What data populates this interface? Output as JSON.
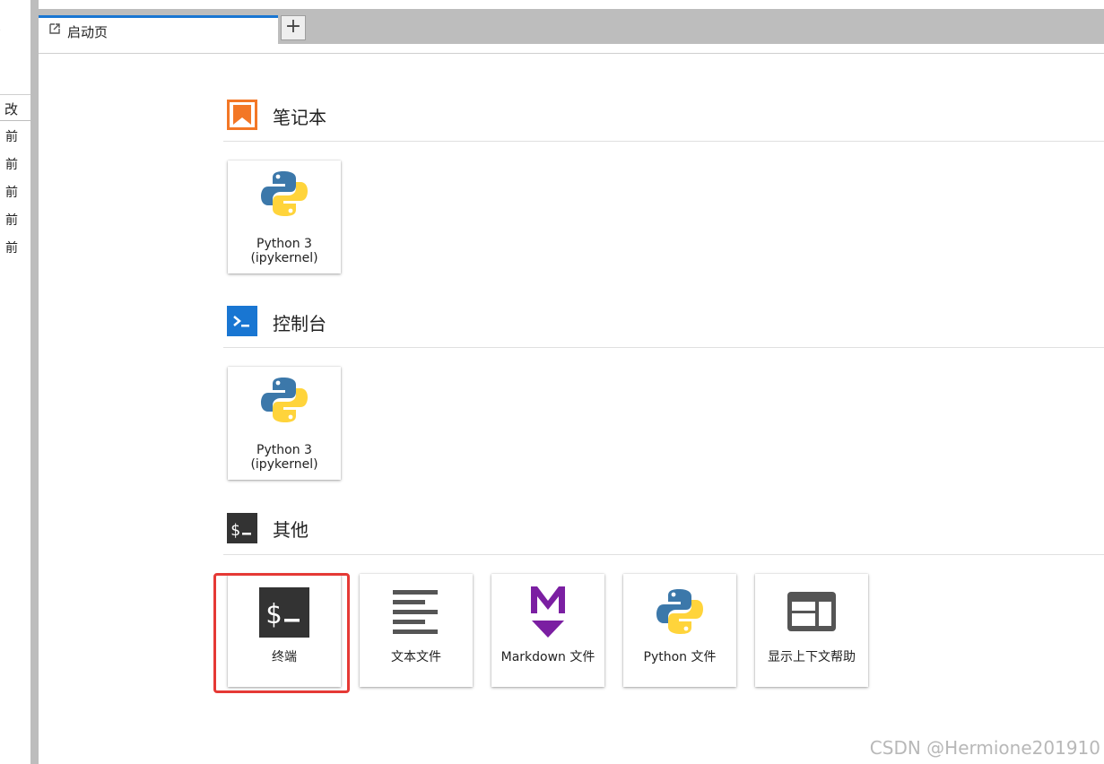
{
  "left_panel": {
    "header_fragment": "改",
    "rows": [
      "前",
      "前",
      "前",
      "前",
      "前"
    ]
  },
  "tabs": [
    {
      "label": "启动页",
      "icon": "launcher-icon",
      "active": true
    }
  ],
  "sections": {
    "notebook": {
      "title": "笔记本",
      "icon": "notebook-bookmark-icon",
      "color": "#f37726",
      "cards": [
        {
          "label_line1": "Python 3",
          "label_line2": "(ipykernel)",
          "icon": "python-logo-icon"
        }
      ]
    },
    "console": {
      "title": "控制台",
      "icon": "console-prompt-icon",
      "color": "#1976d2",
      "cards": [
        {
          "label_line1": "Python 3",
          "label_line2": "(ipykernel)",
          "icon": "python-logo-icon"
        }
      ]
    },
    "other": {
      "title": "其他",
      "icon": "terminal-dollar-icon",
      "color": "#333333",
      "cards": [
        {
          "label": "终端",
          "icon": "terminal-icon"
        },
        {
          "label": "文本文件",
          "icon": "text-file-icon"
        },
        {
          "label": "Markdown 文件",
          "icon": "markdown-icon"
        },
        {
          "label": "Python 文件",
          "icon": "python-logo-icon"
        },
        {
          "label": "显示上下文帮助",
          "icon": "context-help-icon"
        }
      ]
    }
  },
  "colors": {
    "accent_blue": "#1976d2",
    "highlight_red": "#e53935",
    "markdown_purple": "#7b1fa2",
    "python_blue": "#3c78aa",
    "python_yellow": "#ffd43b"
  },
  "watermark": "CSDN @Hermione201910"
}
